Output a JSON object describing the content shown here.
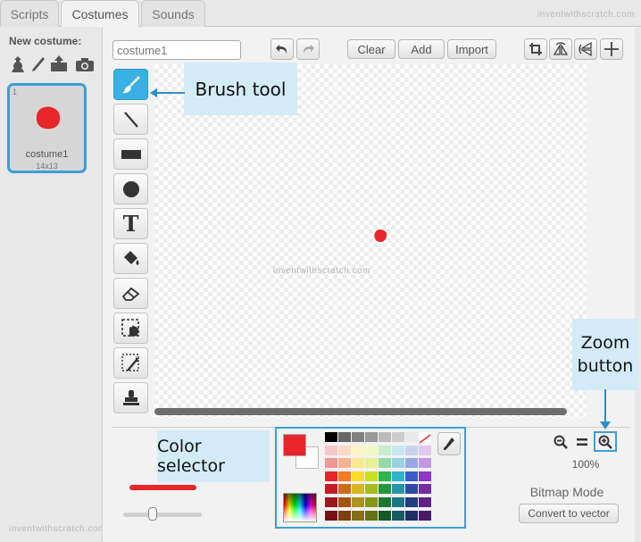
{
  "tabs": [
    {
      "label": "Scripts",
      "active": false
    },
    {
      "label": "Costumes",
      "active": true
    },
    {
      "label": "Sounds",
      "active": false
    }
  ],
  "watermark": "inventwithscratch.com",
  "new_costume": {
    "label": "New costume:",
    "icons": [
      "choose-from-library-icon",
      "paint-new-icon",
      "upload-icon",
      "camera-icon"
    ]
  },
  "costume_list": [
    {
      "index": "1",
      "name": "costume1",
      "size": "14x13",
      "selected": true
    }
  ],
  "editor": {
    "name_value": "costume1",
    "buttons": {
      "clear": "Clear",
      "add": "Add",
      "import": "Import"
    },
    "zoom_level": "100%",
    "mode_label": "Bitmap Mode",
    "convert_label": "Convert to vector",
    "primary_color": "#e8262a",
    "secondary_color": "#ffffff"
  },
  "tools": [
    {
      "name": "brush-tool",
      "icon": "brush-icon",
      "active": true
    },
    {
      "name": "line-tool",
      "icon": "line-icon",
      "active": false
    },
    {
      "name": "rectangle-tool",
      "icon": "rectangle-icon",
      "active": false
    },
    {
      "name": "ellipse-tool",
      "icon": "ellipse-icon",
      "active": false
    },
    {
      "name": "text-tool",
      "icon": "text-icon",
      "active": false
    },
    {
      "name": "fill-tool",
      "icon": "paint-bucket-icon",
      "active": false
    },
    {
      "name": "eraser-tool",
      "icon": "eraser-icon",
      "active": false
    },
    {
      "name": "select-tool",
      "icon": "select-icon",
      "active": false
    },
    {
      "name": "remove-background-tool",
      "icon": "magic-wand-icon",
      "active": false
    },
    {
      "name": "stamp-tool",
      "icon": "stamp-icon",
      "active": false
    }
  ],
  "palette": [
    [
      "#000000",
      "#666666",
      "#808080",
      "#999999",
      "#bbbbbb",
      "#cccccc",
      "#e8e8e8",
      "#ffffff"
    ],
    [
      "#f7c7c8",
      "#fbd9c4",
      "#fff4c4",
      "#f3f8c4",
      "#c8ecd0",
      "#c8e8ef",
      "#c8d4ef",
      "#e0c8ef"
    ],
    [
      "#f09797",
      "#f5b493",
      "#fde896",
      "#e6f093",
      "#97d9a6",
      "#97d2e1",
      "#97a9e1",
      "#c497e1"
    ],
    [
      "#e8262a",
      "#f27a22",
      "#fbdb29",
      "#c8e024",
      "#2eb54f",
      "#2eb3c9",
      "#3b5cc7",
      "#8f36c7"
    ],
    [
      "#c41e24",
      "#cc6a1d",
      "#d6b623",
      "#a5bd1e",
      "#24963f",
      "#2496a8",
      "#2f4aa6",
      "#772ca6"
    ],
    [
      "#9c181c",
      "#a45317",
      "#ad921c",
      "#849818",
      "#1c7632",
      "#1c7886",
      "#253b85",
      "#5f2385"
    ],
    [
      "#741215",
      "#7c3f11",
      "#836e15",
      "#637212",
      "#155926",
      "#155a65",
      "#1c2c64",
      "#471a64"
    ]
  ],
  "callouts": {
    "brush": "Brush tool",
    "zoom_line1": "Zoom",
    "zoom_line2": "button",
    "color": "Color selector"
  }
}
